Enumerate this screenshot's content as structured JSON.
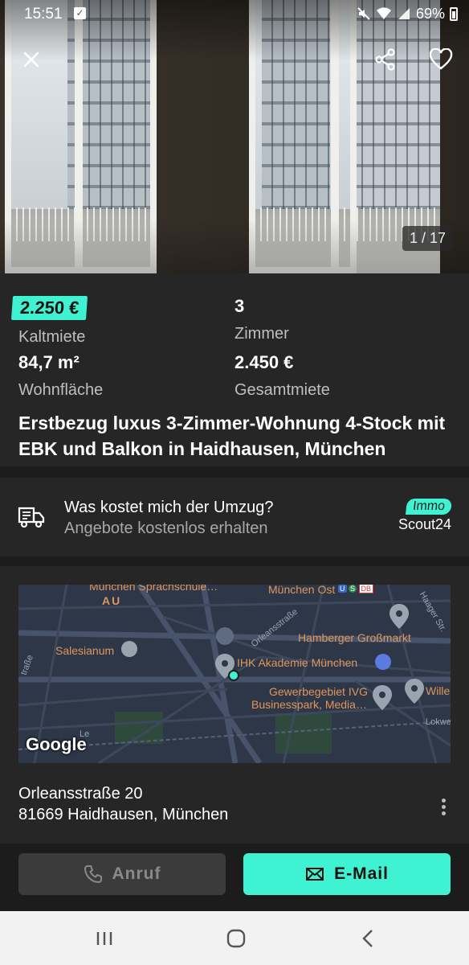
{
  "status_bar": {
    "time": "15:51",
    "battery": "69%",
    "icons": [
      "check-notification-icon",
      "mute-icon",
      "wifi-icon",
      "signal-icon",
      "battery-icon"
    ]
  },
  "gallery": {
    "counter": "1 / 17",
    "icons": [
      "close-icon",
      "share-icon",
      "heart-icon"
    ]
  },
  "facts": {
    "cold_rent_value": "2.250 €",
    "cold_rent_label": "Kaltmiete",
    "rooms_value": "3",
    "rooms_label": "Zimmer",
    "area_value": "84,7 m²",
    "area_label": "Wohnfläche",
    "total_rent_value": "2.450 €",
    "total_rent_label": "Gesamtmiete"
  },
  "listing": {
    "title": "Erstbezug luxus 3-Zimmer-Wohnung 4-Stock mit EBK und Balkon in Haidhausen, München"
  },
  "moving": {
    "question": "Was kostet mich der Umzug?",
    "subtitle": "Angebote kostenlos erhalten",
    "brand_tag": "Immo",
    "brand_name": "Scout24"
  },
  "map": {
    "labels": {
      "school": "München Sprachschule…",
      "au": "AU",
      "station": "München Ost",
      "station_tags": [
        "U",
        "S",
        "DB"
      ],
      "street1": "Orleansstraße",
      "street2": "Haager Str.",
      "street3": "Lokweg",
      "street4": "traße",
      "street5": "Le",
      "hamberger": "Hamberger Großmarkt",
      "salesianum": "Salesianum",
      "ihk": "IHK Akademie München",
      "ivg": "Gewerbegebiet IVG",
      "ivg2": "Businesspark, Media…",
      "wille": "Wille"
    },
    "attribution": "Google"
  },
  "address": {
    "line1": "Orleansstraße 20",
    "line2": "81669 Haidhausen, München"
  },
  "actions": {
    "call_label": "Anruf",
    "mail_label": "E-Mail"
  },
  "colors": {
    "accent": "#3ff3d2",
    "card_bg": "#262626",
    "page_bg": "#1c1c1c",
    "map_bg": "#2d3747",
    "poi": "#e0965a"
  }
}
